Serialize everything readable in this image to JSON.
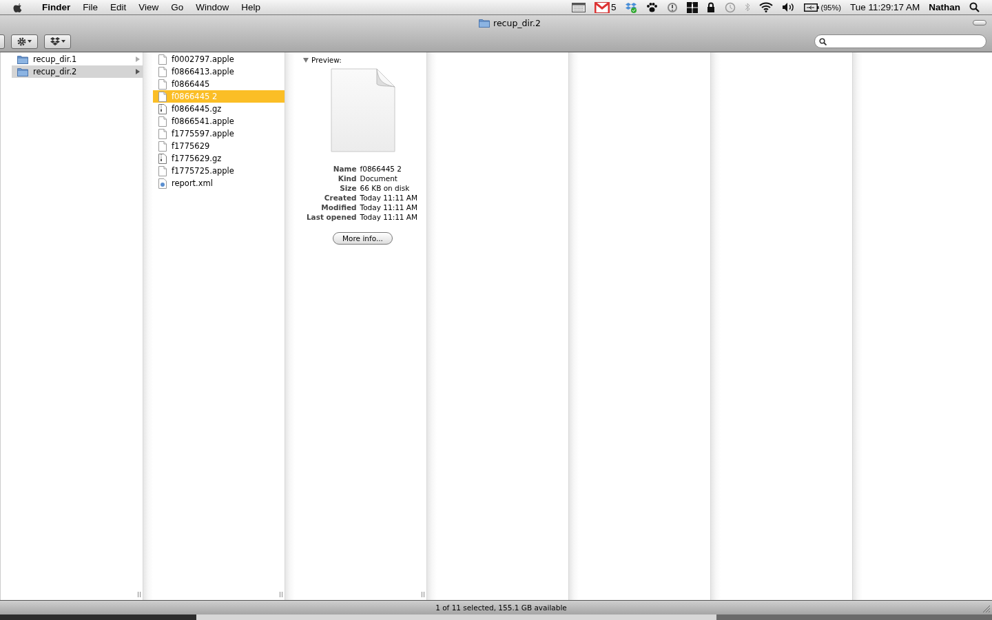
{
  "menu_bar": {
    "app": "Finder",
    "menus": [
      "File",
      "Edit",
      "View",
      "Go",
      "Window",
      "Help"
    ],
    "mail_count": "5",
    "battery": "(95%)",
    "clock": "Tue 11:29:17 AM",
    "user": "Nathan"
  },
  "window": {
    "title": "recup_dir.2"
  },
  "columns": [
    {
      "items": [
        {
          "name": "recup_dir.1",
          "kind": "folder",
          "selected": false
        },
        {
          "name": "recup_dir.2",
          "kind": "folder",
          "selected": true
        }
      ]
    },
    {
      "items": [
        {
          "name": "f0002797.apple",
          "kind": "document",
          "selected": false
        },
        {
          "name": "f0866413.apple",
          "kind": "document",
          "selected": false
        },
        {
          "name": "f0866445",
          "kind": "document",
          "selected": false
        },
        {
          "name": "f0866445 2",
          "kind": "document",
          "selected": true
        },
        {
          "name": "f0866445.gz",
          "kind": "archive",
          "selected": false
        },
        {
          "name": "f0866541.apple",
          "kind": "document",
          "selected": false
        },
        {
          "name": "f1775597.apple",
          "kind": "document",
          "selected": false
        },
        {
          "name": "f1775629",
          "kind": "document",
          "selected": false
        },
        {
          "name": "f1775629.gz",
          "kind": "archive",
          "selected": false
        },
        {
          "name": "f1775725.apple",
          "kind": "document",
          "selected": false
        },
        {
          "name": "report.xml",
          "kind": "xml",
          "selected": false
        }
      ]
    }
  ],
  "preview": {
    "label": "Preview:",
    "expanded": true,
    "info": [
      {
        "label": "Name",
        "value": "f0866445 2"
      },
      {
        "label": "Kind",
        "value": "Document"
      },
      {
        "label": "Size",
        "value": "66 KB on disk"
      },
      {
        "label": "Created",
        "value": "Today 11:11 AM"
      },
      {
        "label": "Modified",
        "value": "Today 11:11 AM"
      },
      {
        "label": "Last opened",
        "value": "Today 11:11 AM"
      }
    ],
    "button": "More info..."
  },
  "status_bar": {
    "text": "1 of 11 selected, 155.1 GB available"
  }
}
